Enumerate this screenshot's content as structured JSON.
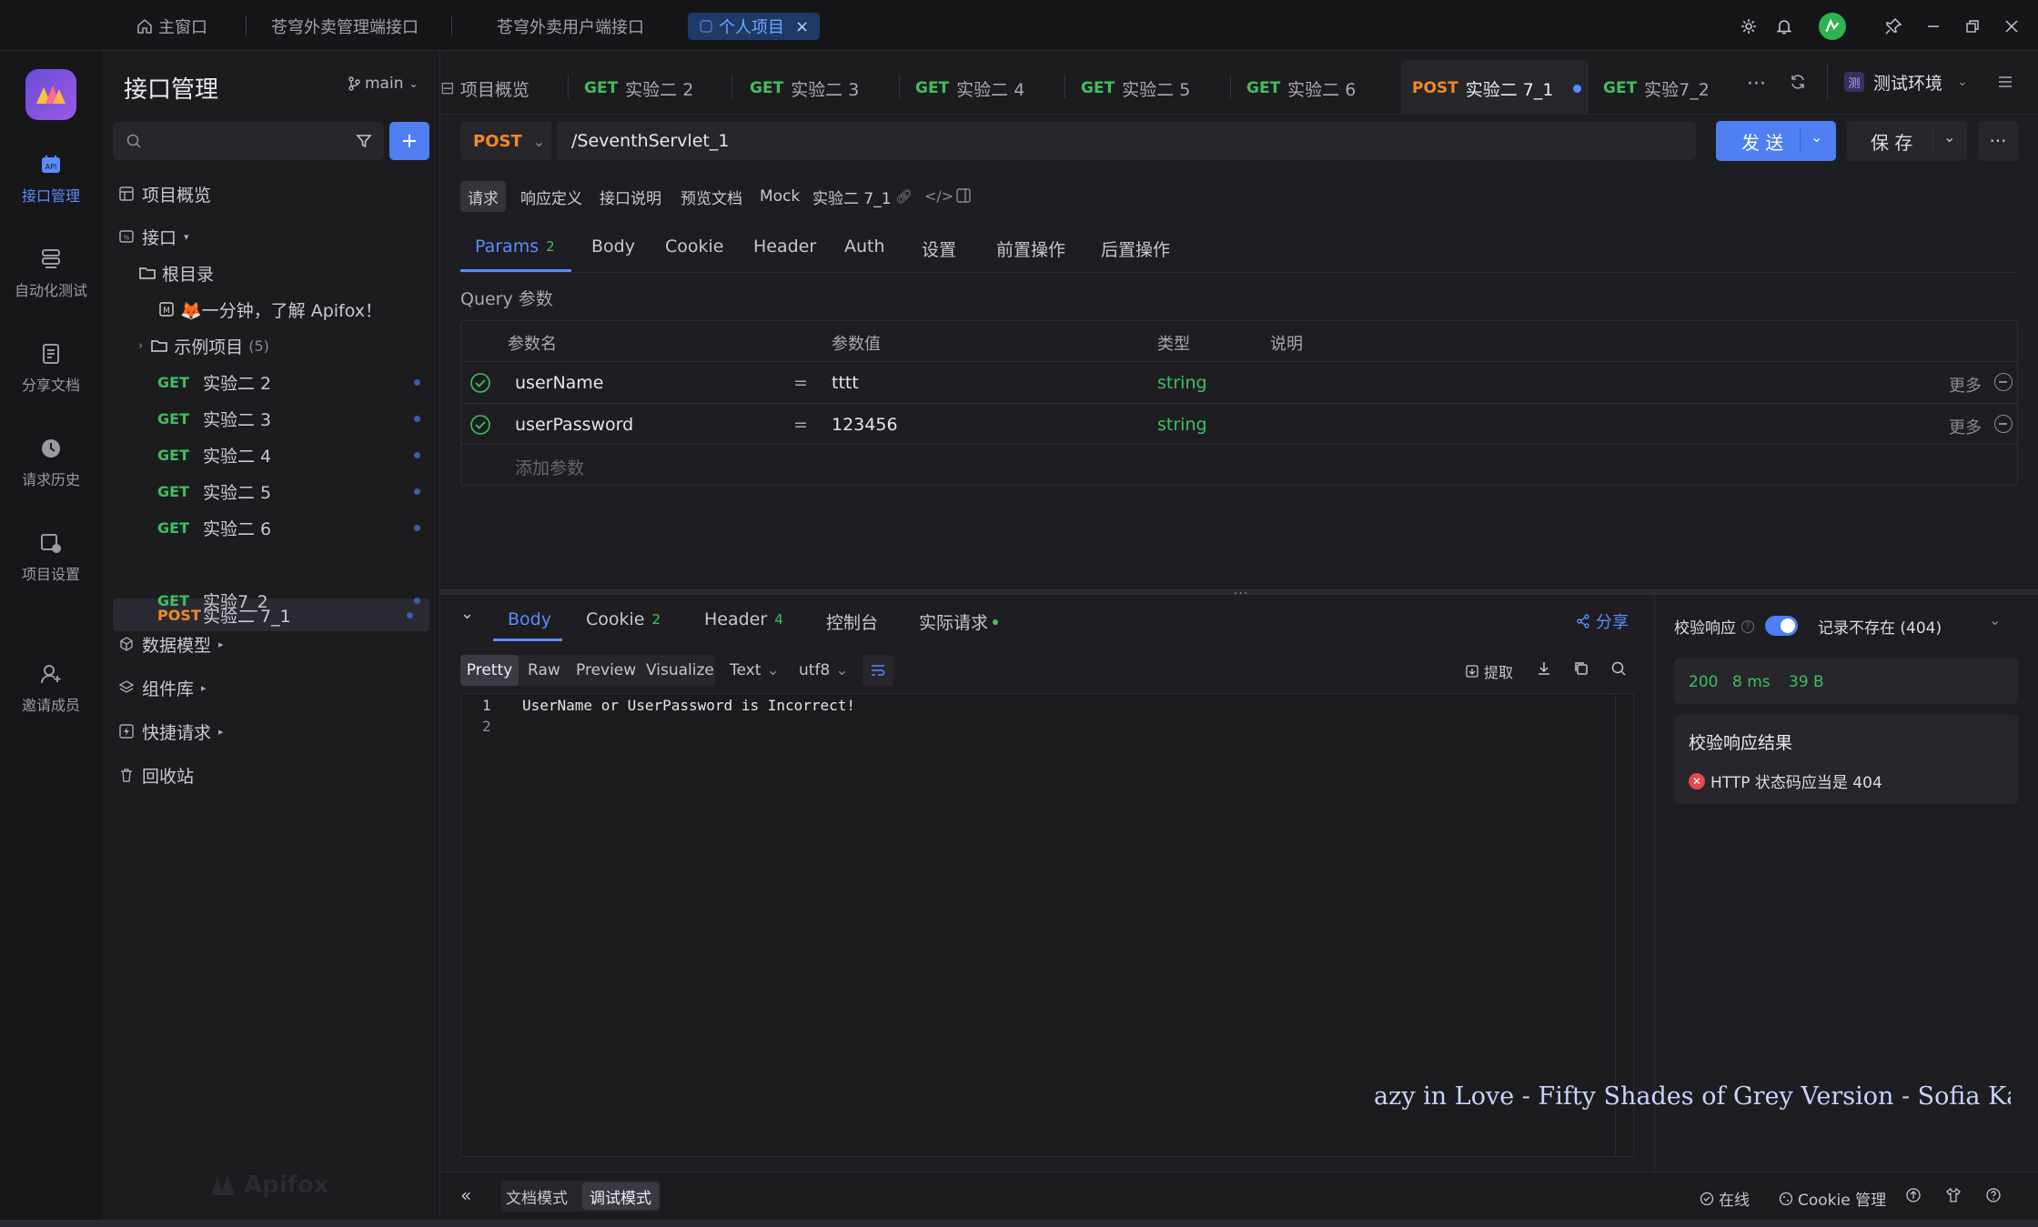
{
  "titlebar": {
    "home": "主窗口",
    "tab1": "苍穹外卖管理端接口",
    "tab2": "苍穹外卖用户端接口",
    "tab3": "个人项目",
    "tab3_close": "×"
  },
  "rail": {
    "api_mgmt": "接口管理",
    "auto_test": "自动化测试",
    "share_docs": "分享文档",
    "history": "请求历史",
    "settings": "项目设置",
    "invite": "邀请成员"
  },
  "sidebar": {
    "title": "接口管理",
    "branch": "main",
    "overview": "项目概览",
    "apis": "接口",
    "root": "根目录",
    "intro": "🦊一分钟，了解 Apifox！",
    "example": "示例项目",
    "example_count": "(5)",
    "items": [
      {
        "method": "GET",
        "name": "实验二 2"
      },
      {
        "method": "GET",
        "name": "实验二 3"
      },
      {
        "method": "GET",
        "name": "实验二 4"
      },
      {
        "method": "GET",
        "name": "实验二 5"
      },
      {
        "method": "GET",
        "name": "实验二 6"
      },
      {
        "method": "POST",
        "name": "实验二 7_1"
      },
      {
        "method": "GET",
        "name": "实验7_2"
      }
    ],
    "data_model": "数据模型",
    "components": "组件库",
    "quick_req": "快捷请求",
    "trash": "回收站",
    "watermark": "Apifox"
  },
  "req_tabs": [
    {
      "method": "",
      "name": "项目概览"
    },
    {
      "method": "GET",
      "name": "实验二 2"
    },
    {
      "method": "GET",
      "name": "实验二 3"
    },
    {
      "method": "GET",
      "name": "实验二 4"
    },
    {
      "method": "GET",
      "name": "实验二 5"
    },
    {
      "method": "GET",
      "name": "实验二 6"
    },
    {
      "method": "POST",
      "name": "实验二 7_1"
    },
    {
      "method": "GET",
      "name": "实验7_2"
    }
  ],
  "env": "测试环境",
  "env_badge": "测",
  "request": {
    "method": "POST",
    "url": "/SeventhServlet_1",
    "send": "发 送",
    "save": "保 存"
  },
  "mode_tabs": [
    "请求",
    "响应定义",
    "接口说明",
    "预览文档",
    "Mock"
  ],
  "api_name": "实验二 7_1",
  "param_tabs": {
    "params": "Params",
    "params_count": "2",
    "body": "Body",
    "cookie": "Cookie",
    "header": "Header",
    "auth": "Auth",
    "settings": "设置",
    "pre": "前置操作",
    "post": "后置操作"
  },
  "query": {
    "label": "Query 参数",
    "col_name": "参数名",
    "col_value": "参数值",
    "col_type": "类型",
    "col_desc": "说明",
    "rows": [
      {
        "name": "userName",
        "eq": "=",
        "value": "tttt",
        "type": "string",
        "more": "更多"
      },
      {
        "name": "userPassword",
        "eq": "=",
        "value": "123456",
        "type": "string",
        "more": "更多"
      }
    ],
    "add": "添加参数"
  },
  "response": {
    "tabs": {
      "body": "Body",
      "cookie": "Cookie",
      "cookie_count": "2",
      "header": "Header",
      "header_count": "4",
      "console": "控制台",
      "actual": "实际请求"
    },
    "share": "分享",
    "views": [
      "Pretty",
      "Raw",
      "Preview",
      "Visualize"
    ],
    "format": "Text",
    "encoding": "utf8",
    "extract": "提取",
    "lines": [
      {
        "no": "1",
        "text": "UserName or UserPassword is Incorrect!"
      },
      {
        "no": "2",
        "text": ""
      }
    ]
  },
  "validate": {
    "label": "校验响应",
    "record": "记录不存在 (404)",
    "status": "200",
    "time": "8 ms",
    "size": "39 B",
    "result_title": "校验响应结果",
    "result_msg": "HTTP 状态码应当是 404"
  },
  "overlay_text": "azy in Love - Fifty Shades of Grey Version - Sofia Karlberg",
  "bottom": {
    "doc_mode": "文档模式",
    "debug_mode": "调试模式",
    "online": "在线",
    "cookie_mgmt": "Cookie 管理"
  },
  "colors": {
    "accent": "#5b8cff",
    "get": "#3fbf5f",
    "post": "#f08a24",
    "error": "#e5484d"
  }
}
